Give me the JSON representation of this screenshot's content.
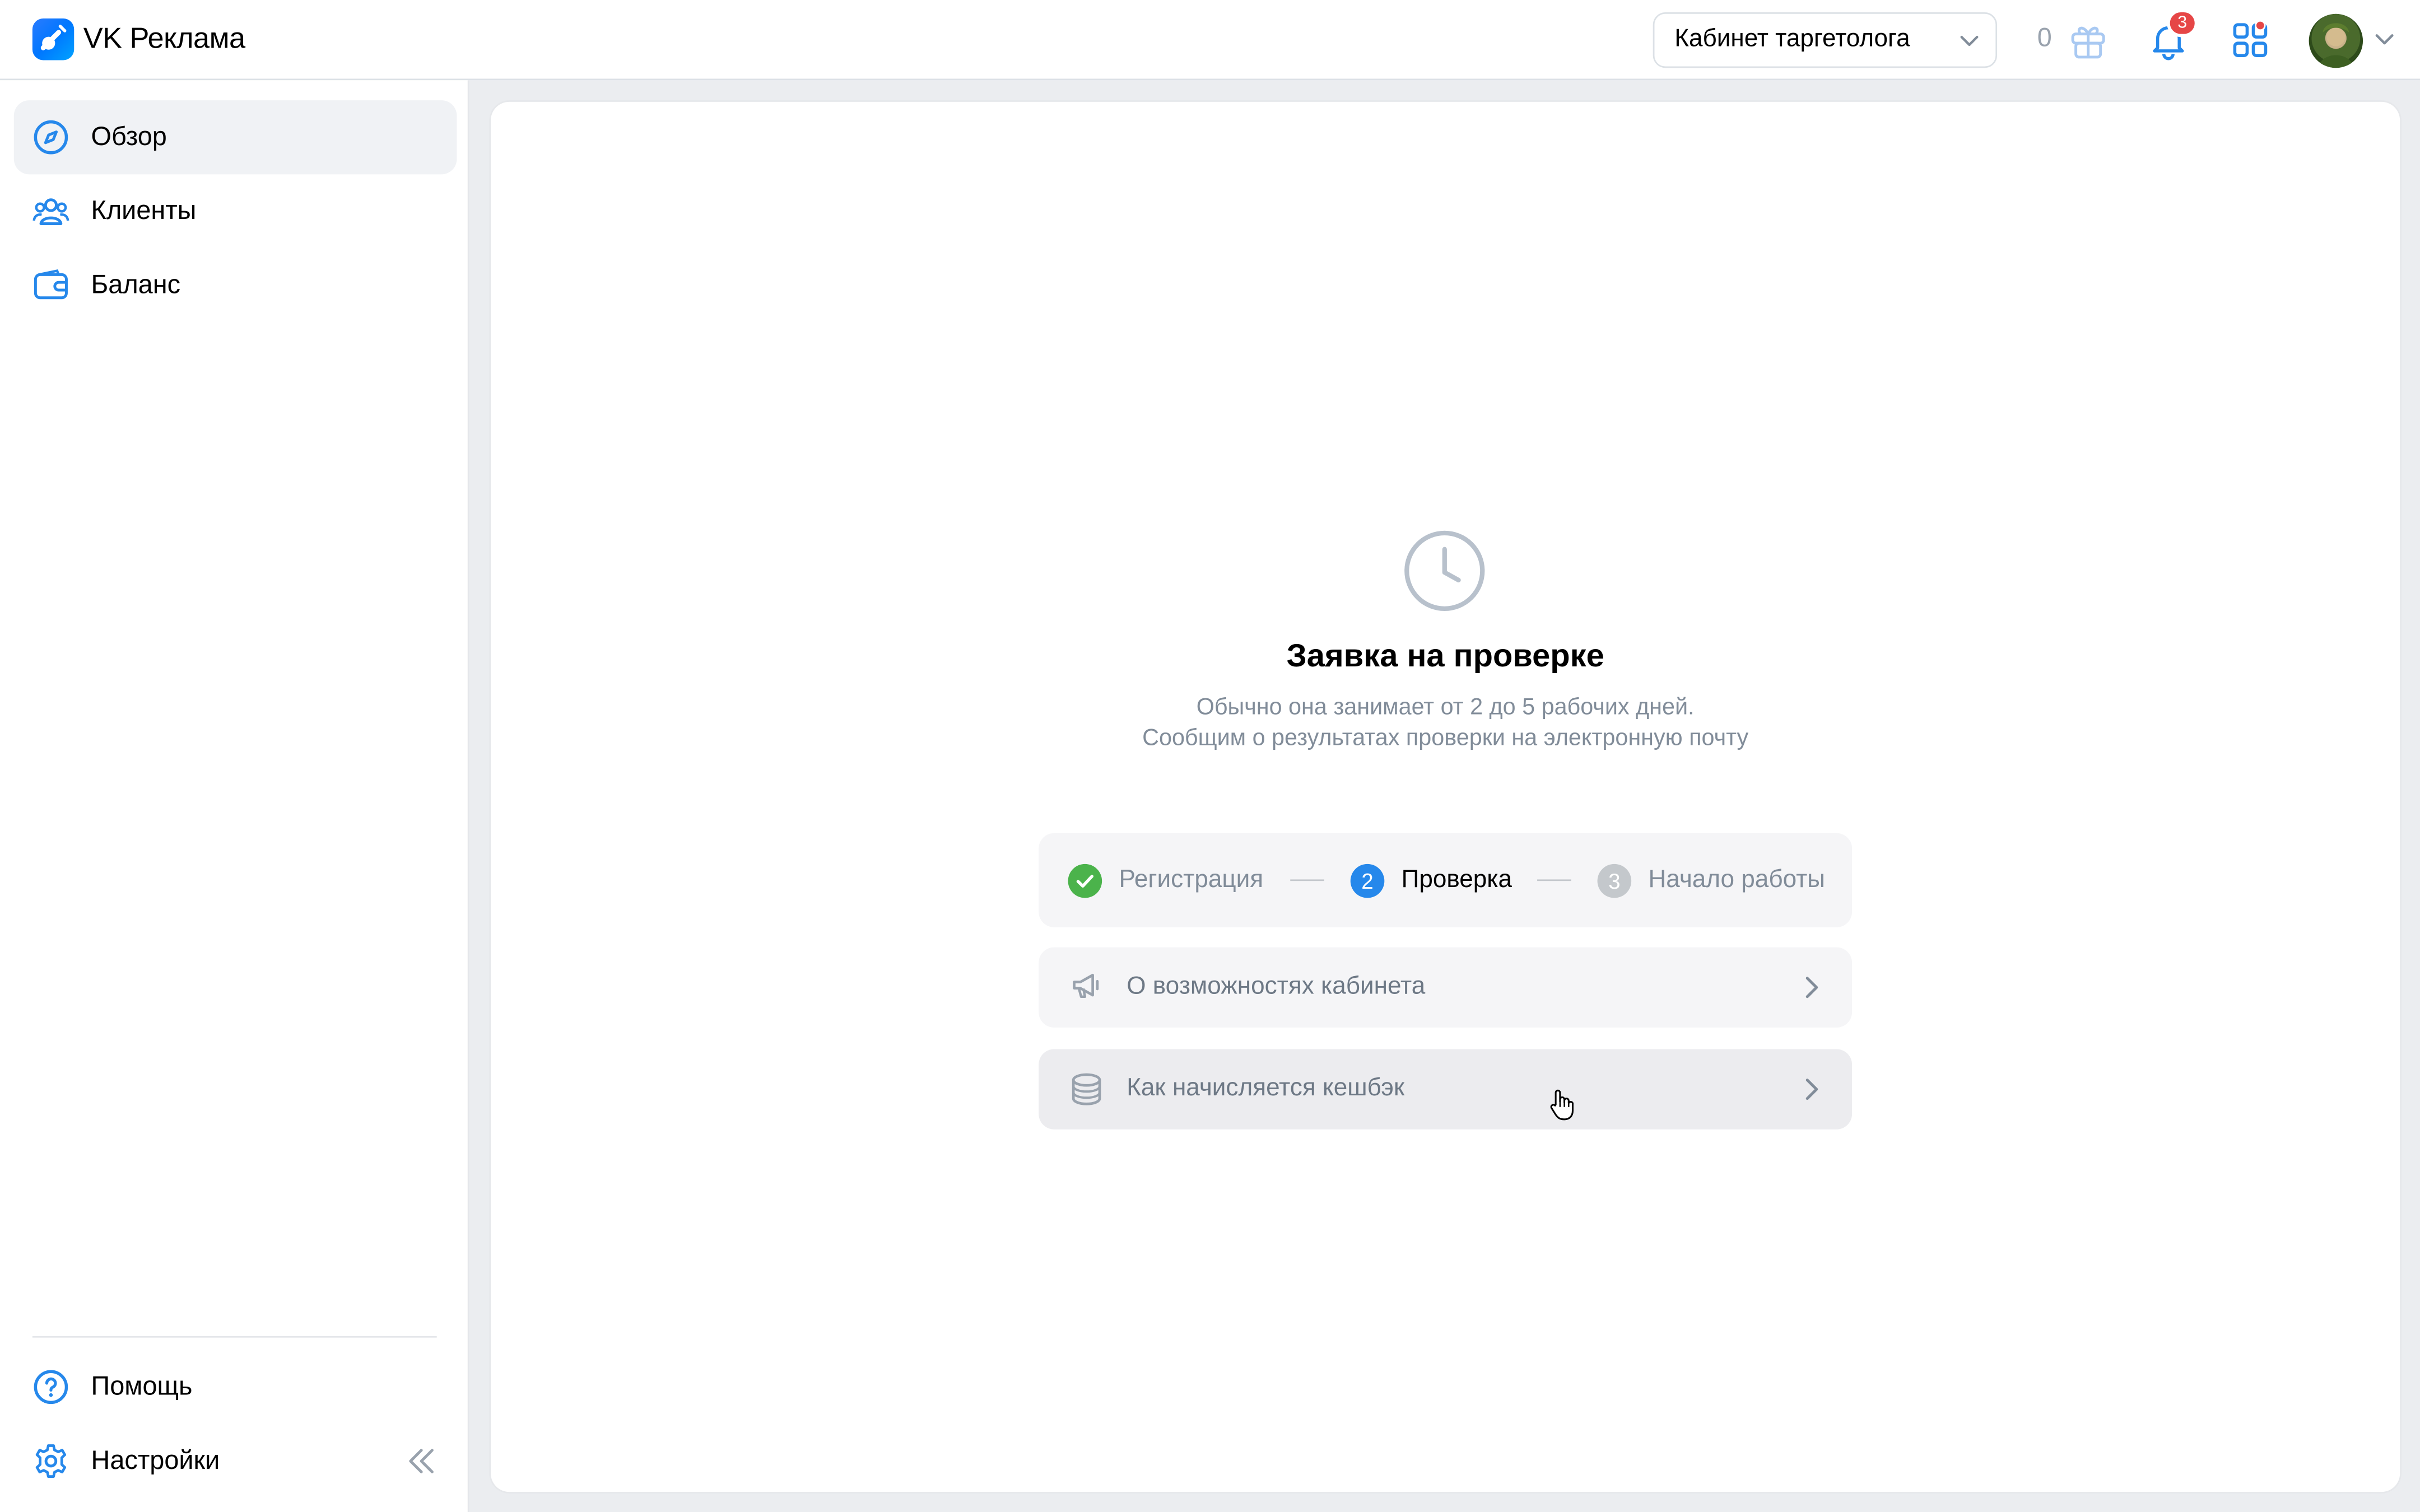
{
  "header": {
    "brand": "VK Реклама",
    "cabinet_selector": "Кабинет таргетолога",
    "gift_count": "0",
    "notifications_badge": "3"
  },
  "sidebar": {
    "items": [
      {
        "label": "Обзор",
        "icon": "compass-icon",
        "active": true
      },
      {
        "label": "Клиенты",
        "icon": "users-icon",
        "active": false
      },
      {
        "label": "Баланс",
        "icon": "wallet-icon",
        "active": false
      }
    ],
    "bottom_items": [
      {
        "label": "Помощь",
        "icon": "help-circle-icon"
      },
      {
        "label": "Настройки",
        "icon": "gear-icon"
      }
    ]
  },
  "main": {
    "status_icon": "clock-icon",
    "title": "Заявка на проверке",
    "subtitle_line1": "Обычно она занимает от 2 до 5 рабочих дней.",
    "subtitle_line2": "Сообщим о результатах проверки на электронную почту",
    "steps": [
      {
        "number": "1",
        "label": "Регистрация",
        "state": "done"
      },
      {
        "number": "2",
        "label": "Проверка",
        "state": "current"
      },
      {
        "number": "3",
        "label": "Начало работы",
        "state": "pending"
      }
    ],
    "actions": [
      {
        "label": "О возможностях кабинета",
        "icon": "megaphone-icon"
      },
      {
        "label": "Как начисляется кешбэк",
        "icon": "coins-icon"
      }
    ]
  },
  "colors": {
    "accent": "#2688eb",
    "success": "#4bb34b",
    "badge": "#e64646",
    "muted": "#818c99"
  }
}
